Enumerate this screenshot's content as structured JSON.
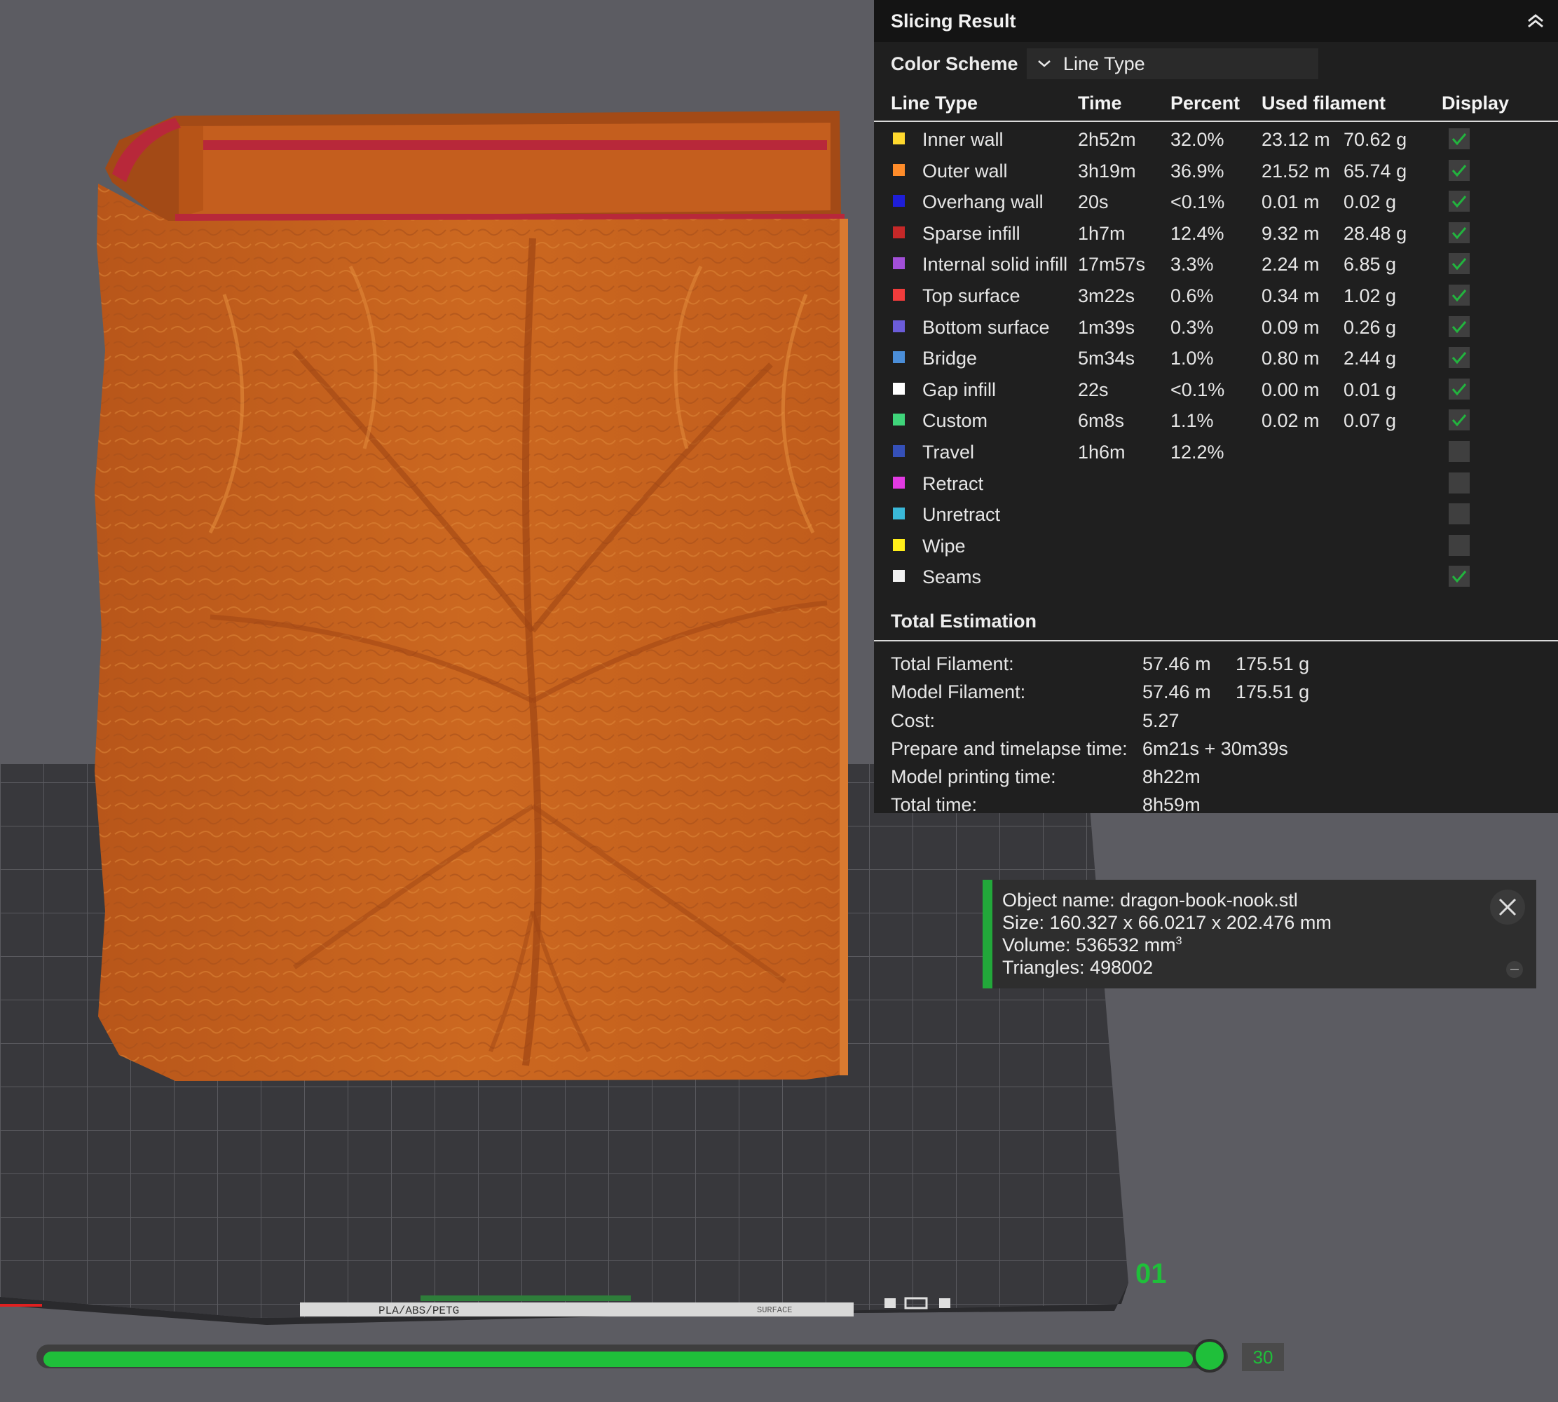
{
  "panel": {
    "title": "Slicing Result",
    "color_scheme_label": "Color Scheme",
    "color_scheme_value": "Line Type",
    "columns": [
      "Line Type",
      "Time",
      "Percent",
      "Used filament",
      "Display"
    ],
    "rows": [
      {
        "name": "Inner wall",
        "color": "#ffd92e",
        "time": "2h52m",
        "percent": "32.0%",
        "length": "23.12 m",
        "weight": "70.62 g",
        "display": true
      },
      {
        "name": "Outer wall",
        "color": "#ff8c2a",
        "time": "3h19m",
        "percent": "36.9%",
        "length": "21.52 m",
        "weight": "65.74 g",
        "display": true
      },
      {
        "name": "Overhang wall",
        "color": "#1e1ed8",
        "time": "20s",
        "percent": "<0.1%",
        "length": "0.01 m",
        "weight": "0.02 g",
        "display": true
      },
      {
        "name": "Sparse infill",
        "color": "#c62828",
        "time": "1h7m",
        "percent": "12.4%",
        "length": "9.32 m",
        "weight": "28.48 g",
        "display": true
      },
      {
        "name": "Internal solid infill",
        "color": "#a24fd8",
        "time": "17m57s",
        "percent": "3.3%",
        "length": "2.24 m",
        "weight": "6.85 g",
        "display": true
      },
      {
        "name": "Top surface",
        "color": "#f03c3c",
        "time": "3m22s",
        "percent": "0.6%",
        "length": "0.34 m",
        "weight": "1.02 g",
        "display": true
      },
      {
        "name": "Bottom surface",
        "color": "#6b5cd9",
        "time": "1m39s",
        "percent": "0.3%",
        "length": "0.09 m",
        "weight": "0.26 g",
        "display": true
      },
      {
        "name": "Bridge",
        "color": "#4b8ed8",
        "time": "5m34s",
        "percent": "1.0%",
        "length": "0.80 m",
        "weight": "2.44 g",
        "display": true
      },
      {
        "name": "Gap infill",
        "color": "#ffffff",
        "time": "22s",
        "percent": "<0.1%",
        "length": "0.00 m",
        "weight": "0.01 g",
        "display": true
      },
      {
        "name": "Custom",
        "color": "#3fd47a",
        "time": "6m8s",
        "percent": "1.1%",
        "length": "0.02 m",
        "weight": "0.07 g",
        "display": true
      },
      {
        "name": "Travel",
        "color": "#3550b8",
        "time": "1h6m",
        "percent": "12.2%",
        "length": "",
        "weight": "",
        "display": false
      },
      {
        "name": "Retract",
        "color": "#e23ae2",
        "time": "",
        "percent": "",
        "length": "",
        "weight": "",
        "display": false
      },
      {
        "name": "Unretract",
        "color": "#3ab8d8",
        "time": "",
        "percent": "",
        "length": "",
        "weight": "",
        "display": false
      },
      {
        "name": "Wipe",
        "color": "#ffee1a",
        "time": "",
        "percent": "",
        "length": "",
        "weight": "",
        "display": false
      },
      {
        "name": "Seams",
        "color": "#f2f2f2",
        "time": "",
        "percent": "",
        "length": "",
        "weight": "",
        "display": true
      }
    ],
    "total_title": "Total Estimation",
    "totals": [
      {
        "label": "Total Filament:",
        "v1": "57.46 m",
        "v2": "175.51 g"
      },
      {
        "label": "Model Filament:",
        "v1": "57.46 m",
        "v2": "175.51 g"
      },
      {
        "label": "Cost:",
        "v1": "5.27",
        "v2": ""
      },
      {
        "label": "Prepare and timelapse time:",
        "v1": "6m21s + 30m39s",
        "v2": ""
      },
      {
        "label": "Model printing time:",
        "v1": "8h22m",
        "v2": ""
      },
      {
        "label": "Total time:",
        "v1": "8h59m",
        "v2": ""
      }
    ]
  },
  "object_info": {
    "name_line": "Object name: dragon-book-nook.stl",
    "size_line": "Size: 160.327 x 66.0217 x 202.476 mm",
    "volume_line": "Volume: 536532 mm",
    "volume_unit_sup": "3",
    "triangles_line": "Triangles: 498002"
  },
  "plate": {
    "number": "01",
    "label_text": "PLA/ABS/PETG",
    "surface_text": "SURFACE"
  },
  "layer_slider": {
    "value": "30",
    "fraction": 1.0
  },
  "colors": {
    "accent_green": "#1fbf3a",
    "model_orange": "#c9621a",
    "panel_bg": "#1f1f1f"
  }
}
